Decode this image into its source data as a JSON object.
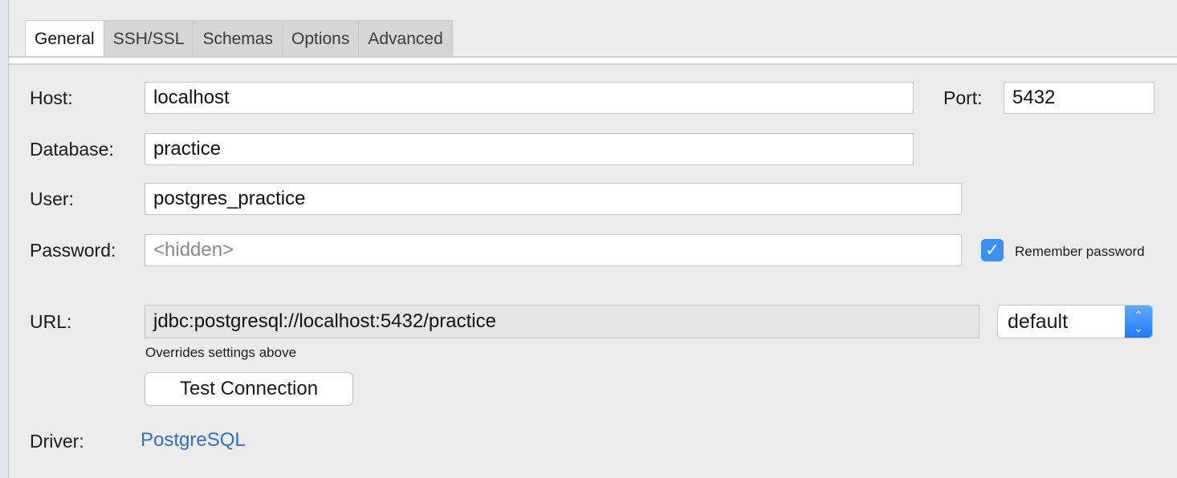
{
  "tabs": [
    "General",
    "SSH/SSL",
    "Schemas",
    "Options",
    "Advanced"
  ],
  "active_tab": "General",
  "form": {
    "host_label": "Host:",
    "host_value": "localhost",
    "port_label": "Port:",
    "port_value": "5432",
    "database_label": "Database:",
    "database_value": "practice",
    "user_label": "User:",
    "user_value": "postgres_practice",
    "password_label": "Password:",
    "password_placeholder": "<hidden>",
    "remember_password_label": "Remember password",
    "remember_password_checked": true,
    "url_label": "URL:",
    "url_value": "jdbc:postgresql://localhost:5432/practice",
    "url_mode": "default",
    "url_hint": "Overrides settings above",
    "test_connection_label": "Test Connection",
    "driver_label": "Driver:",
    "driver_value": "PostgreSQL"
  },
  "colors": {
    "accent": "#3d8ef5",
    "link": "#2e72c0"
  }
}
